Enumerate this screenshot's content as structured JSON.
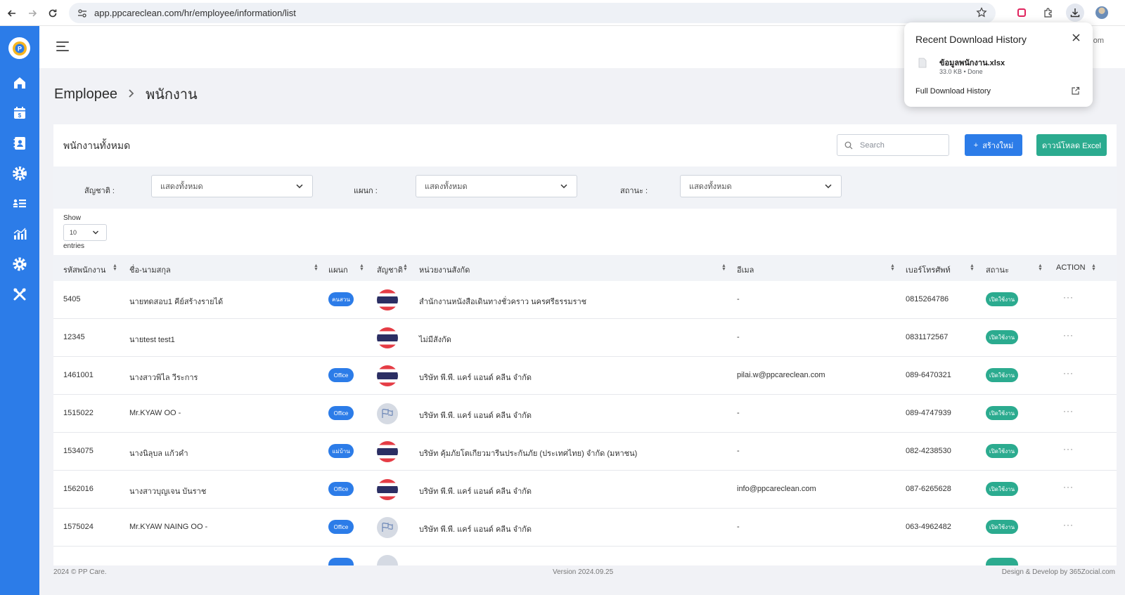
{
  "browser": {
    "url": "app.ppcareclean.com/hr/employee/information/list"
  },
  "header": {
    "user_name": "dom"
  },
  "breadcrumb": {
    "parent": "Emplopee",
    "current": "พนักงาน"
  },
  "card": {
    "title": "พนักงานทั้งหมด",
    "search_placeholder": "Search",
    "create_label": "สร้างใหม่",
    "excel_label": "ดาวน์โหลด Excel"
  },
  "filters": {
    "nationality_label": "สัญชาติ :",
    "nationality_value": "แสดงทั้งหมด",
    "department_label": "แผนก :",
    "department_value": "แสดงทั้งหมด",
    "status_label": "สถานะ :",
    "status_value": "แสดงทั้งหมด"
  },
  "pagination": {
    "show_label": "Show",
    "page_size": "10",
    "entries_label": "entries"
  },
  "table": {
    "columns": [
      "รหัสพนักงาน",
      "ชื่อ-นามสกุล",
      "แผนก",
      "สัญชาติ",
      "หน่วยงานสังกัด",
      "อีเมล",
      "เบอร์โทรศัพท์",
      "สถานะ",
      "ACTION"
    ],
    "rows": [
      {
        "id": "5405",
        "name": "นายทดสอบ1 คีย์สร้างรายได้",
        "dept": "คนสวน",
        "flag": "thai",
        "agency": "สำนักงานหนังสือเดินทางชั่วคราว นครศรีธรรมราช",
        "email": "-",
        "phone": "0815264786",
        "status": "เปิดใช้งาน"
      },
      {
        "id": "12345",
        "name": "นายtest test1",
        "dept": "",
        "flag": "thai",
        "agency": "ไม่มีสังกัด",
        "email": "-",
        "phone": "0831172567",
        "status": "เปิดใช้งาน"
      },
      {
        "id": "1461001",
        "name": "นางสาวพิไล วีระการ",
        "dept": "Office",
        "flag": "thai",
        "agency": "บริษัท พี.พี. แคร์ แอนด์ คลีน จำกัด",
        "email": "pilai.w@ppcareclean.com",
        "phone": "089-6470321",
        "status": "เปิดใช้งาน"
      },
      {
        "id": "1515022",
        "name": "Mr.KYAW OO -",
        "dept": "Office",
        "flag": "myan",
        "agency": "บริษัท พี.พี. แคร์ แอนด์ คลีน จำกัด",
        "email": "-",
        "phone": "089-4747939",
        "status": "เปิดใช้งาน"
      },
      {
        "id": "1534075",
        "name": "นางนิลุบล แก้วคำ",
        "dept": "แม่บ้าน",
        "flag": "thai",
        "agency": "บริษัท คุ้มภัยโตเกียวมารีนประกันภัย (ประเทศไทย) จำกัด (มหาชน)",
        "email": "-",
        "phone": "082-4238530",
        "status": "เปิดใช้งาน"
      },
      {
        "id": "1562016",
        "name": "นางสาวบุญเจน บันราช",
        "dept": "Office",
        "flag": "thai",
        "agency": "บริษัท พี.พี. แคร์ แอนด์ คลีน จำกัด",
        "email": "info@ppcareclean.com",
        "phone": "087-6265628",
        "status": "เปิดใช้งาน"
      },
      {
        "id": "1575024",
        "name": "Mr.KYAW NAING OO -",
        "dept": "Office",
        "flag": "myan",
        "agency": "บริษัท พี.พี. แคร์ แอนด์ คลีน จำกัด",
        "email": "-",
        "phone": "063-4962482",
        "status": "เปิดใช้งาน"
      }
    ]
  },
  "footer": {
    "copyright": "2024 © PP Care.",
    "version": "Version 2024.09.25",
    "credit": "Design & Develop by 365Zocial.com"
  },
  "download_popup": {
    "title": "Recent Download History",
    "file_name": "ข้อมูลพนักงาน.xlsx",
    "file_meta": "33.0 KB • Done",
    "full_history_label": "Full Download History"
  },
  "colors": {
    "primary": "#2c7ce8",
    "success": "#2bab8f"
  }
}
